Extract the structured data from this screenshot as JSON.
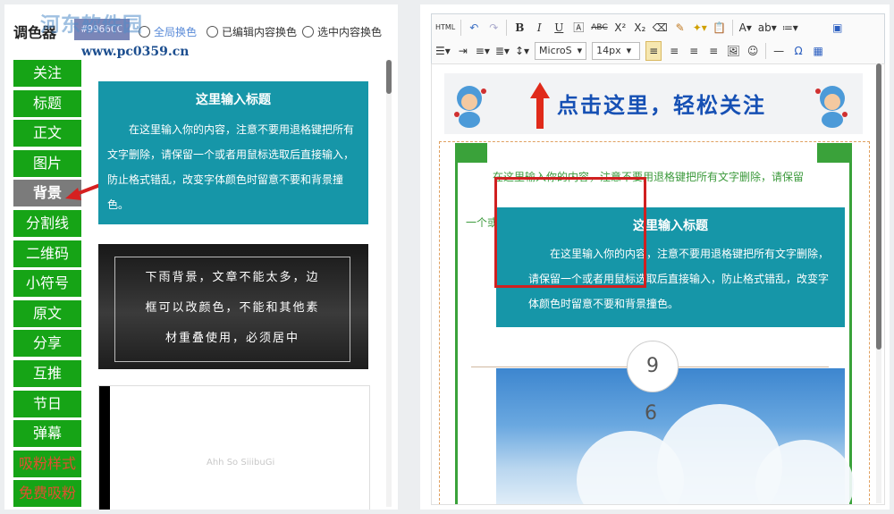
{
  "left": {
    "tool_name": "调色器",
    "color_value": "#9966CC",
    "radios": [
      {
        "label": "全局换色"
      },
      {
        "label": "已编辑内容换色"
      },
      {
        "label": "选中内容换色"
      }
    ],
    "watermark": "河东软件园",
    "watermark_url": "www.pc0359.cn",
    "nav": [
      {
        "label": "关注"
      },
      {
        "label": "标题"
      },
      {
        "label": "正文"
      },
      {
        "label": "图片"
      },
      {
        "label": "背景",
        "active": true
      },
      {
        "label": "分割线"
      },
      {
        "label": "二维码"
      },
      {
        "label": "小符号"
      },
      {
        "label": "原文"
      },
      {
        "label": "分享"
      },
      {
        "label": "互推"
      },
      {
        "label": "节日"
      },
      {
        "label": "弹幕"
      },
      {
        "label": "吸粉样式"
      },
      {
        "label": "免费吸粉"
      }
    ],
    "card1": {
      "title": "这里输入标题",
      "body": "在这里输入你的内容，注意不要用退格键把所有文字删除，请保留一个或者用鼠标选取后直接输入，防止格式错乱，改变字体颜色时留意不要和背景撞色。"
    },
    "card2": {
      "line1": "下雨背景，文章不能太多，边",
      "line2": "框可以改颜色，不能和其他素",
      "line3": "材重叠使用，必须居中"
    },
    "card3_ghost": "Ahh So SiiibuGi"
  },
  "right": {
    "toolbar": {
      "html": "HTML",
      "bold": "B",
      "italic": "I",
      "underline": "U",
      "font_family": "MicroS",
      "font_size": "14px"
    },
    "banner_text": "点击这里，轻松关注",
    "intro_line1": "在这里输入你的内容，注意不要用退格键把所有文字删除，请保留",
    "intro_line2": "一个或者用鼠标选取后",
    "card": {
      "title": "这里输入标题",
      "body": "在这里输入你的内容，注意不要用退格键把所有文字删除，请保留一个或者用鼠标选取后直接输入，防止格式错乱，改变字体颜色时留意不要和背景撞色。"
    },
    "number_circle": "9",
    "number_below": "6"
  },
  "colors": {
    "nav_green": "#16a416",
    "nav_active": "#7b7b7b",
    "card_teal": "#1696a8",
    "highlight_red": "#d02020"
  }
}
